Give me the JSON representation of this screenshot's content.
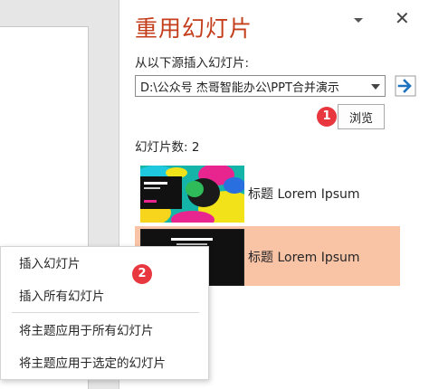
{
  "pane": {
    "title": "重用幻灯片",
    "source_label": "从以下源插入幻灯片:",
    "source_value": "D:\\公众号 杰哥智能办公\\PPT合并演示",
    "browse_label": "浏览",
    "count_label": "幻灯片数: 2",
    "dropdown_icon": "chevron-down-icon",
    "close_icon": "close-icon",
    "go_icon": "arrow-right-icon",
    "accent_color": "#c43e1c"
  },
  "slides": [
    {
      "label": "标题 Lorem Ipsum",
      "selected": false
    },
    {
      "label": "标题 Lorem Ipsum",
      "selected": true,
      "highlight_color": "#f9c3a6"
    }
  ],
  "context_menu": {
    "items": [
      "插入幻灯片",
      "插入所有幻灯片",
      "将主题应用于所有幻灯片",
      "将主题应用于选定的幻灯片"
    ]
  },
  "badges": [
    "1",
    "2"
  ]
}
